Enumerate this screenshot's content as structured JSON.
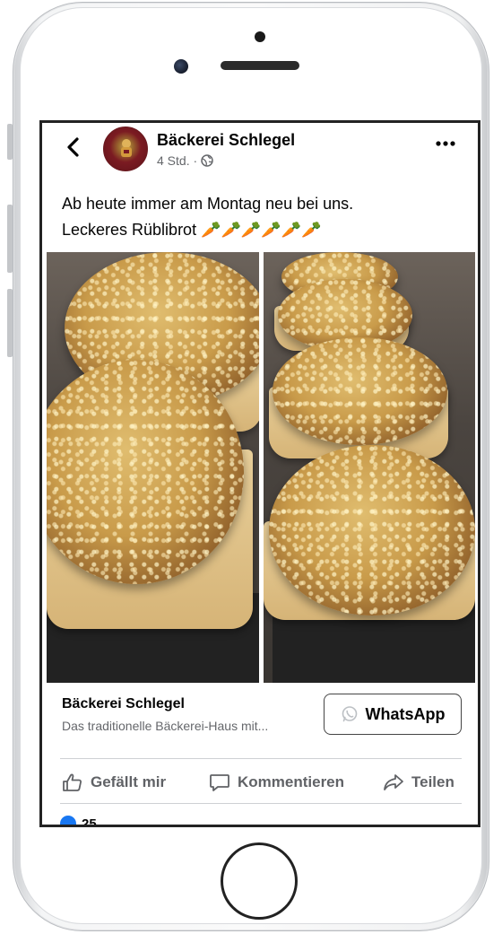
{
  "post": {
    "page_name": "Bäckerei Schlegel",
    "time": "4 Std. ·",
    "text_line1": "Ab heute immer am Montag neu bei uns.",
    "text_line2": "Leckeres Rüblibrot 🥕🥕🥕🥕🥕🥕",
    "visibility_icon": "globe-icon"
  },
  "link": {
    "title": "Bäckerei Schlegel",
    "description": "Das traditionelle Bäckerei-Haus mit...",
    "button_label": "WhatsApp",
    "button_icon": "whatsapp-icon"
  },
  "actions": {
    "like": "Gefällt mir",
    "comment": "Kommentieren",
    "share": "Teilen"
  },
  "reactions": {
    "count": "25"
  },
  "colors": {
    "accent": "#1877f2",
    "secondary_text": "#65676b"
  }
}
